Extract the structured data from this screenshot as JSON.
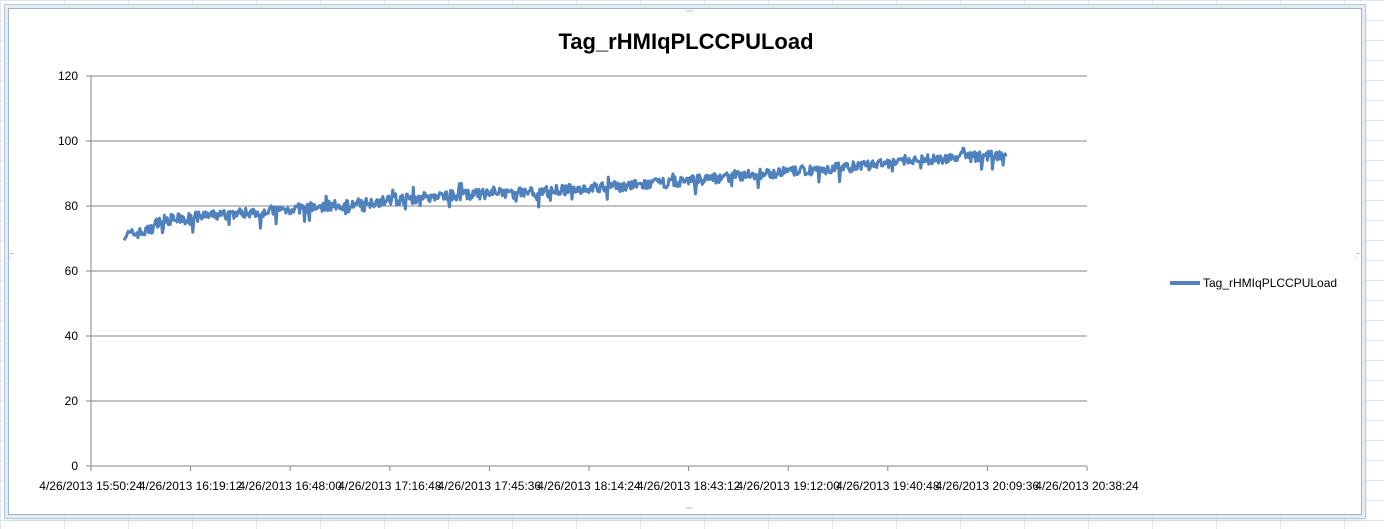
{
  "chart_data": {
    "type": "line",
    "title": "Tag_rHMIqPLCCPULoad",
    "xlabel": "",
    "ylabel": "",
    "ylim": [
      0,
      120
    ],
    "yticks": [
      0,
      20,
      40,
      60,
      80,
      100,
      120
    ],
    "xlim": [
      "4/26/2013 15:50:24",
      "4/26/2013 20:38:24"
    ],
    "xtick_labels": [
      "4/26/2013 15:50:24",
      "4/26/2013 16:19:12",
      "4/26/2013 16:48:00",
      "4/26/2013 17:16:48",
      "4/26/2013 17:45:36",
      "4/26/2013 18:14:24",
      "4/26/2013 18:43:12",
      "4/26/2013 19:12:00",
      "4/26/2013 19:40:48",
      "4/26/2013 20:09:36",
      "4/26/2013 20:38:24"
    ],
    "grid": true,
    "legend": "right",
    "series": [
      {
        "name": "Tag_rHMIqPLCCPULoad",
        "color": "#4f81bd",
        "x": [
          "4/26/2013 16:00",
          "4/26/2013 16:06",
          "4/26/2013 16:08",
          "4/26/2013 16:10",
          "4/26/2013 16:30",
          "4/26/2013 17:00",
          "4/26/2013 17:30",
          "4/26/2013 18:00",
          "4/26/2013 18:30",
          "4/26/2013 19:00",
          "4/26/2013 19:30",
          "4/26/2013 20:00",
          "4/26/2013 20:15"
        ],
        "y": [
          71,
          72,
          73,
          75.5,
          77.5,
          80,
          83,
          84.5,
          86.5,
          89.5,
          92,
          95,
          95.5
        ]
      }
    ]
  }
}
